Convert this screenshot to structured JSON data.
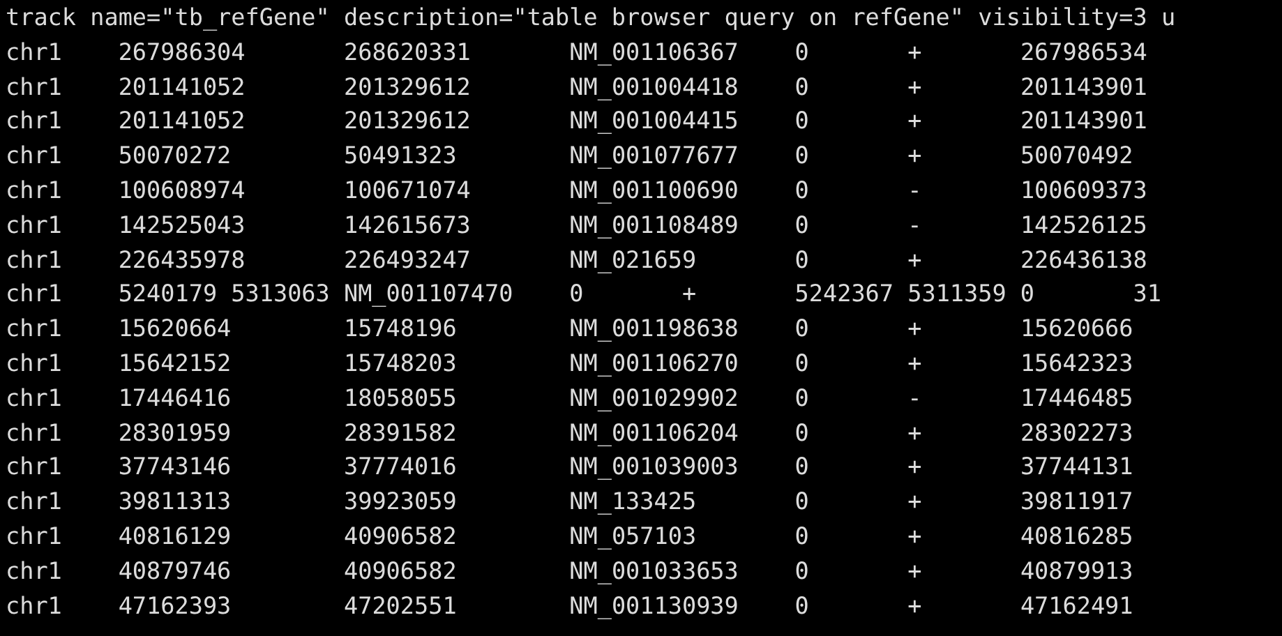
{
  "header": "track name=\"tb_refGene\" description=\"table browser query on refGene\" visibility=3 u",
  "rows": [
    [
      "chr1",
      "267986304",
      "268620331",
      "NM_001106367",
      "0",
      "+",
      "267986534"
    ],
    [
      "chr1",
      "201141052",
      "201329612",
      "NM_001004418",
      "0",
      "+",
      "201143901"
    ],
    [
      "chr1",
      "201141052",
      "201329612",
      "NM_001004415",
      "0",
      "+",
      "201143901"
    ],
    [
      "chr1",
      "50070272",
      "50491323",
      "NM_001077677",
      "0",
      "+",
      "50070492"
    ],
    [
      "chr1",
      "100608974",
      "100671074",
      "NM_001100690",
      "0",
      "-",
      "100609373"
    ],
    [
      "chr1",
      "142525043",
      "142615673",
      "NM_001108489",
      "0",
      "-",
      "142526125"
    ],
    [
      "chr1",
      "226435978",
      "226493247",
      "NM_021659",
      "0",
      "+",
      "226436138"
    ],
    [
      "chr1",
      "5240179 5313063 NM_001107470",
      "0",
      "+",
      "5242367 5311359 0",
      "31"
    ],
    [
      "chr1",
      "15620664",
      "15748196",
      "NM_001198638",
      "0",
      "+",
      "15620666"
    ],
    [
      "chr1",
      "15642152",
      "15748203",
      "NM_001106270",
      "0",
      "+",
      "15642323"
    ],
    [
      "chr1",
      "17446416",
      "18058055",
      "NM_001029902",
      "0",
      "-",
      "17446485"
    ],
    [
      "chr1",
      "28301959",
      "28391582",
      "NM_001106204",
      "0",
      "+",
      "28302273"
    ],
    [
      "chr1",
      "37743146",
      "37774016",
      "NM_001039003",
      "0",
      "+",
      "37744131"
    ],
    [
      "chr1",
      "39811313",
      "39923059",
      "NM_133425",
      "0",
      "+",
      "39811917"
    ],
    [
      "chr1",
      "40816129",
      "40906582",
      "NM_057103",
      "0",
      "+",
      "40816285"
    ],
    [
      "chr1",
      "40879746",
      "40906582",
      "NM_001033653",
      "0",
      "+",
      "40879913"
    ],
    [
      "chr1",
      "47162393",
      "47202551",
      "NM_001130939",
      "0",
      "+",
      "47162491"
    ]
  ]
}
